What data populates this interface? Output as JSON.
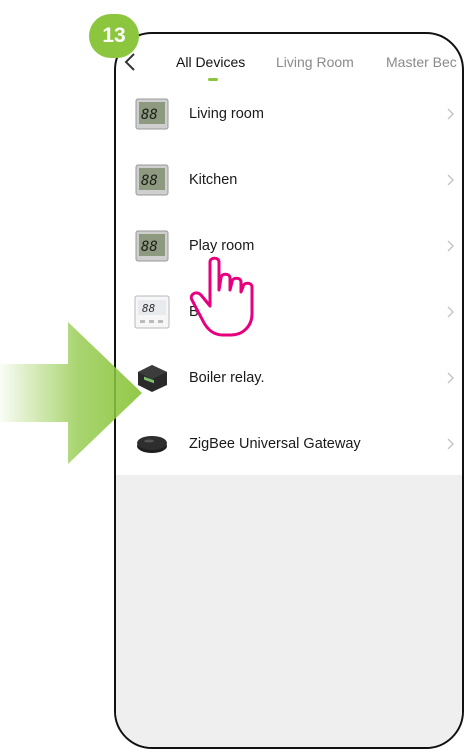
{
  "step_badge": "13",
  "tabs": [
    {
      "label": "All Devices",
      "active": true
    },
    {
      "label": "Living Room",
      "active": false
    },
    {
      "label": "Master Bec",
      "active": false
    }
  ],
  "devices": [
    {
      "name": "Living room",
      "icon": "lcd-thermostat-icon"
    },
    {
      "name": "Kitchen",
      "icon": "lcd-thermostat-icon"
    },
    {
      "name": "Play room",
      "icon": "lcd-thermostat-icon"
    },
    {
      "name": "Ba",
      "name_tail": "n",
      "icon": "white-thermostat-icon"
    },
    {
      "name": "Boiler relay.",
      "icon": "relay-module-icon"
    },
    {
      "name": "ZigBee Universal Gateway",
      "icon": "gateway-hub-icon"
    }
  ],
  "colors": {
    "accent": "#8cc63f",
    "pointer": "#e6007e"
  }
}
